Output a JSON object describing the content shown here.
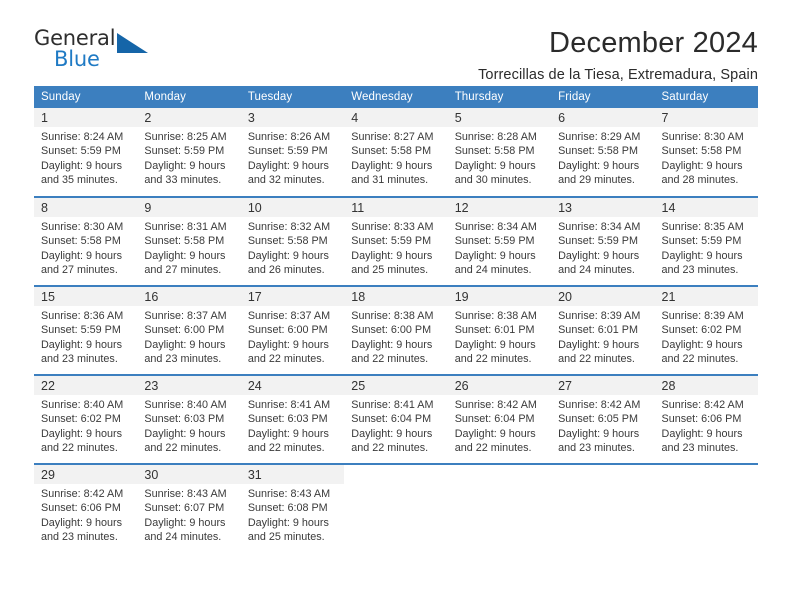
{
  "brand": {
    "name_part1": "General",
    "name_part2": "Blue",
    "triangle_icon": "blue-triangle-logo-mark",
    "colors": {
      "dark": "#2e2e2e",
      "blue": "#1f7ac4",
      "triangle": "#1565a8"
    }
  },
  "header": {
    "title": "December 2024",
    "subtitle": "Torrecillas de la Tiesa, Extremadura, Spain"
  },
  "calendar": {
    "accent_color": "#3c7fbf",
    "daynum_background": "#f2f2f2",
    "day_headers": [
      "Sunday",
      "Monday",
      "Tuesday",
      "Wednesday",
      "Thursday",
      "Friday",
      "Saturday"
    ],
    "weeks": [
      [
        {
          "day": "1",
          "sunrise": "Sunrise: 8:24 AM",
          "sunset": "Sunset: 5:59 PM",
          "daylight1": "Daylight: 9 hours",
          "daylight2": "and 35 minutes."
        },
        {
          "day": "2",
          "sunrise": "Sunrise: 8:25 AM",
          "sunset": "Sunset: 5:59 PM",
          "daylight1": "Daylight: 9 hours",
          "daylight2": "and 33 minutes."
        },
        {
          "day": "3",
          "sunrise": "Sunrise: 8:26 AM",
          "sunset": "Sunset: 5:59 PM",
          "daylight1": "Daylight: 9 hours",
          "daylight2": "and 32 minutes."
        },
        {
          "day": "4",
          "sunrise": "Sunrise: 8:27 AM",
          "sunset": "Sunset: 5:58 PM",
          "daylight1": "Daylight: 9 hours",
          "daylight2": "and 31 minutes."
        },
        {
          "day": "5",
          "sunrise": "Sunrise: 8:28 AM",
          "sunset": "Sunset: 5:58 PM",
          "daylight1": "Daylight: 9 hours",
          "daylight2": "and 30 minutes."
        },
        {
          "day": "6",
          "sunrise": "Sunrise: 8:29 AM",
          "sunset": "Sunset: 5:58 PM",
          "daylight1": "Daylight: 9 hours",
          "daylight2": "and 29 minutes."
        },
        {
          "day": "7",
          "sunrise": "Sunrise: 8:30 AM",
          "sunset": "Sunset: 5:58 PM",
          "daylight1": "Daylight: 9 hours",
          "daylight2": "and 28 minutes."
        }
      ],
      [
        {
          "day": "8",
          "sunrise": "Sunrise: 8:30 AM",
          "sunset": "Sunset: 5:58 PM",
          "daylight1": "Daylight: 9 hours",
          "daylight2": "and 27 minutes."
        },
        {
          "day": "9",
          "sunrise": "Sunrise: 8:31 AM",
          "sunset": "Sunset: 5:58 PM",
          "daylight1": "Daylight: 9 hours",
          "daylight2": "and 27 minutes."
        },
        {
          "day": "10",
          "sunrise": "Sunrise: 8:32 AM",
          "sunset": "Sunset: 5:58 PM",
          "daylight1": "Daylight: 9 hours",
          "daylight2": "and 26 minutes."
        },
        {
          "day": "11",
          "sunrise": "Sunrise: 8:33 AM",
          "sunset": "Sunset: 5:59 PM",
          "daylight1": "Daylight: 9 hours",
          "daylight2": "and 25 minutes."
        },
        {
          "day": "12",
          "sunrise": "Sunrise: 8:34 AM",
          "sunset": "Sunset: 5:59 PM",
          "daylight1": "Daylight: 9 hours",
          "daylight2": "and 24 minutes."
        },
        {
          "day": "13",
          "sunrise": "Sunrise: 8:34 AM",
          "sunset": "Sunset: 5:59 PM",
          "daylight1": "Daylight: 9 hours",
          "daylight2": "and 24 minutes."
        },
        {
          "day": "14",
          "sunrise": "Sunrise: 8:35 AM",
          "sunset": "Sunset: 5:59 PM",
          "daylight1": "Daylight: 9 hours",
          "daylight2": "and 23 minutes."
        }
      ],
      [
        {
          "day": "15",
          "sunrise": "Sunrise: 8:36 AM",
          "sunset": "Sunset: 5:59 PM",
          "daylight1": "Daylight: 9 hours",
          "daylight2": "and 23 minutes."
        },
        {
          "day": "16",
          "sunrise": "Sunrise: 8:37 AM",
          "sunset": "Sunset: 6:00 PM",
          "daylight1": "Daylight: 9 hours",
          "daylight2": "and 23 minutes."
        },
        {
          "day": "17",
          "sunrise": "Sunrise: 8:37 AM",
          "sunset": "Sunset: 6:00 PM",
          "daylight1": "Daylight: 9 hours",
          "daylight2": "and 22 minutes."
        },
        {
          "day": "18",
          "sunrise": "Sunrise: 8:38 AM",
          "sunset": "Sunset: 6:00 PM",
          "daylight1": "Daylight: 9 hours",
          "daylight2": "and 22 minutes."
        },
        {
          "day": "19",
          "sunrise": "Sunrise: 8:38 AM",
          "sunset": "Sunset: 6:01 PM",
          "daylight1": "Daylight: 9 hours",
          "daylight2": "and 22 minutes."
        },
        {
          "day": "20",
          "sunrise": "Sunrise: 8:39 AM",
          "sunset": "Sunset: 6:01 PM",
          "daylight1": "Daylight: 9 hours",
          "daylight2": "and 22 minutes."
        },
        {
          "day": "21",
          "sunrise": "Sunrise: 8:39 AM",
          "sunset": "Sunset: 6:02 PM",
          "daylight1": "Daylight: 9 hours",
          "daylight2": "and 22 minutes."
        }
      ],
      [
        {
          "day": "22",
          "sunrise": "Sunrise: 8:40 AM",
          "sunset": "Sunset: 6:02 PM",
          "daylight1": "Daylight: 9 hours",
          "daylight2": "and 22 minutes."
        },
        {
          "day": "23",
          "sunrise": "Sunrise: 8:40 AM",
          "sunset": "Sunset: 6:03 PM",
          "daylight1": "Daylight: 9 hours",
          "daylight2": "and 22 minutes."
        },
        {
          "day": "24",
          "sunrise": "Sunrise: 8:41 AM",
          "sunset": "Sunset: 6:03 PM",
          "daylight1": "Daylight: 9 hours",
          "daylight2": "and 22 minutes."
        },
        {
          "day": "25",
          "sunrise": "Sunrise: 8:41 AM",
          "sunset": "Sunset: 6:04 PM",
          "daylight1": "Daylight: 9 hours",
          "daylight2": "and 22 minutes."
        },
        {
          "day": "26",
          "sunrise": "Sunrise: 8:42 AM",
          "sunset": "Sunset: 6:04 PM",
          "daylight1": "Daylight: 9 hours",
          "daylight2": "and 22 minutes."
        },
        {
          "day": "27",
          "sunrise": "Sunrise: 8:42 AM",
          "sunset": "Sunset: 6:05 PM",
          "daylight1": "Daylight: 9 hours",
          "daylight2": "and 23 minutes."
        },
        {
          "day": "28",
          "sunrise": "Sunrise: 8:42 AM",
          "sunset": "Sunset: 6:06 PM",
          "daylight1": "Daylight: 9 hours",
          "daylight2": "and 23 minutes."
        }
      ],
      [
        {
          "day": "29",
          "sunrise": "Sunrise: 8:42 AM",
          "sunset": "Sunset: 6:06 PM",
          "daylight1": "Daylight: 9 hours",
          "daylight2": "and 23 minutes."
        },
        {
          "day": "30",
          "sunrise": "Sunrise: 8:43 AM",
          "sunset": "Sunset: 6:07 PM",
          "daylight1": "Daylight: 9 hours",
          "daylight2": "and 24 minutes."
        },
        {
          "day": "31",
          "sunrise": "Sunrise: 8:43 AM",
          "sunset": "Sunset: 6:08 PM",
          "daylight1": "Daylight: 9 hours",
          "daylight2": "and 25 minutes."
        },
        {
          "day": "",
          "sunrise": "",
          "sunset": "",
          "daylight1": "",
          "daylight2": ""
        },
        {
          "day": "",
          "sunrise": "",
          "sunset": "",
          "daylight1": "",
          "daylight2": ""
        },
        {
          "day": "",
          "sunrise": "",
          "sunset": "",
          "daylight1": "",
          "daylight2": ""
        },
        {
          "day": "",
          "sunrise": "",
          "sunset": "",
          "daylight1": "",
          "daylight2": ""
        }
      ]
    ]
  }
}
